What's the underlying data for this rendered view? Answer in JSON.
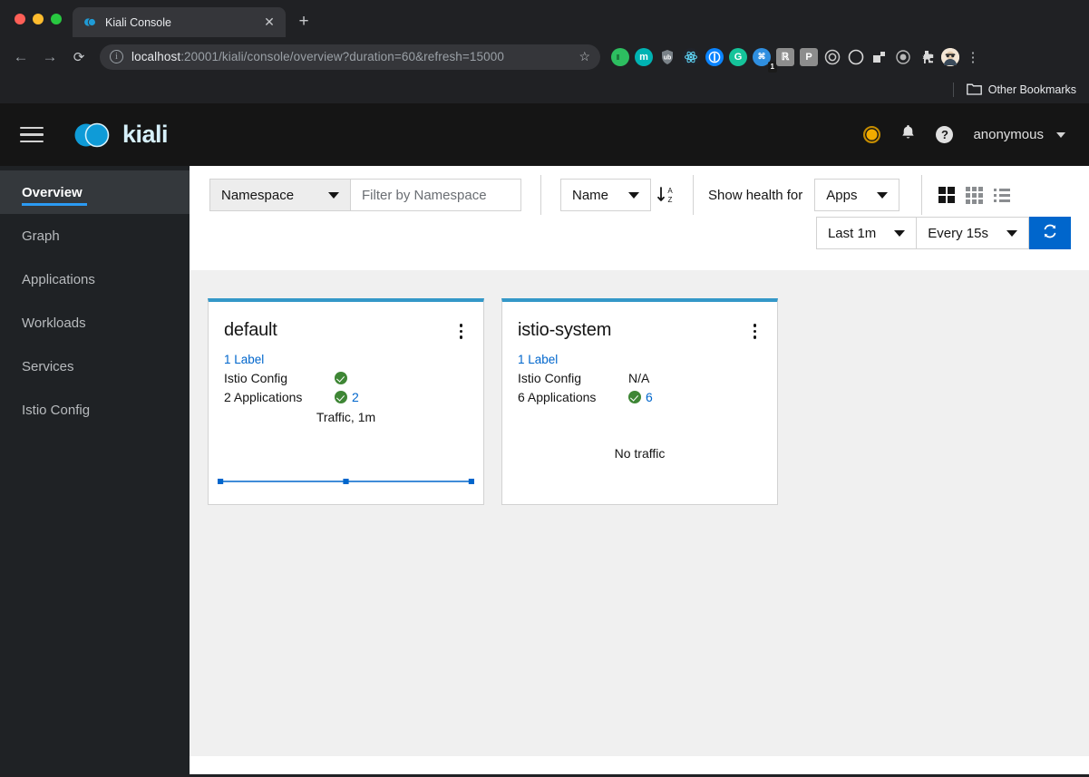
{
  "browser": {
    "tab": {
      "title": "Kiali Console",
      "favicon": "kiali-favicon",
      "close_label": "✕"
    },
    "new_tab_label": "+",
    "nav": {
      "back": "←",
      "forward": "→",
      "reload": "⟳"
    },
    "omnibox": {
      "info_glyph": "i",
      "url_host": "localhost",
      "url_rest": ":20001/kiali/console/overview?duration=60&refresh=15000",
      "star": "☆"
    },
    "extensions": [
      {
        "name": "evernote-extension-icon",
        "color": "#2dbe60",
        "glyph": "❦"
      },
      {
        "name": "mega-extension-icon",
        "color": "#00b3b3",
        "glyph": "m"
      },
      {
        "name": "ublock-extension-icon",
        "color": "#7a8288",
        "glyph": "ü"
      },
      {
        "name": "react-devtools-extension-icon",
        "color": "#20232a",
        "glyph": "⚛"
      },
      {
        "name": "onepassword-extension-icon",
        "color": "#0a84ff",
        "glyph": "Ⓘ"
      },
      {
        "name": "grammarly-extension-icon",
        "color": "#15c39a",
        "glyph": "G"
      },
      {
        "name": "grasshopper-extension-icon",
        "color": "#2f8fe0",
        "glyph": "⌘",
        "badge": "1"
      },
      {
        "name": "honey-extension-icon",
        "color": "#8d8d8d",
        "glyph": "฿"
      },
      {
        "name": "pocket-extension-icon",
        "color": "#8d8d8d",
        "glyph": "P"
      },
      {
        "name": "target-extension-icon",
        "color": "#1b1b1b",
        "glyph": "◎"
      },
      {
        "name": "moon-extension-icon",
        "color": "#1b1b1b",
        "glyph": "◔"
      },
      {
        "name": "layers-extension-icon",
        "color": "#1b1b1b",
        "glyph": "⬛"
      },
      {
        "name": "disc-extension-icon",
        "color": "#1b1b1b",
        "glyph": "◉"
      },
      {
        "name": "puzzle-extensions-icon",
        "color": "#1b1b1b",
        "glyph": "❖"
      },
      {
        "name": "profile-avatar",
        "color": "#f2e3cf",
        "glyph": "☺"
      }
    ],
    "menu_glyph": "⋮",
    "bookmarks": {
      "folder_icon": "folder-icon",
      "other_bookmarks": "Other Bookmarks"
    }
  },
  "masthead": {
    "hamburger": "menu-icon",
    "brand": "kiali",
    "istio_status": "istio-status-warning-icon",
    "notifications": "bell-icon",
    "help": "help-icon",
    "user": "anonymous",
    "user_caret": "chevron-down-icon"
  },
  "sidebar": {
    "items": [
      {
        "label": "Overview",
        "active": true
      },
      {
        "label": "Graph",
        "active": false
      },
      {
        "label": "Applications",
        "active": false
      },
      {
        "label": "Workloads",
        "active": false
      },
      {
        "label": "Services",
        "active": false
      },
      {
        "label": "Istio Config",
        "active": false
      }
    ]
  },
  "toolbar": {
    "filter_type": "Namespace",
    "filter_placeholder": "Filter by Namespace",
    "filter_value": "",
    "sort_by": "Name",
    "sort_direction_icon": "sort-descending-az-icon",
    "health_label": "Show health for",
    "health_for": "Apps",
    "views": [
      {
        "name": "expand-view-icon",
        "selected": true
      },
      {
        "name": "compact-grid-view-icon",
        "selected": false
      },
      {
        "name": "list-view-icon",
        "selected": false
      }
    ],
    "duration": "Last 1m",
    "refresh_interval": "Every 15s",
    "refresh_button_icon": "refresh-icon"
  },
  "cards": [
    {
      "name": "default",
      "kebab": "card-actions-icon",
      "labels": "1 Label",
      "istio_config_label": "Istio Config",
      "istio_config_status": "healthy",
      "istio_config_value": "",
      "apps_label": "2 Applications",
      "apps_status": "healthy",
      "apps_value": "2",
      "traffic_label": "Traffic, 1m",
      "has_sparkline": true,
      "no_traffic_label": ""
    },
    {
      "name": "istio-system",
      "kebab": "card-actions-icon",
      "labels": "1 Label",
      "istio_config_label": "Istio Config",
      "istio_config_status": "na",
      "istio_config_value": "N/A",
      "apps_label": "6 Applications",
      "apps_status": "healthy",
      "apps_value": "6",
      "traffic_label": "",
      "has_sparkline": false,
      "no_traffic_label": "No traffic"
    }
  ],
  "chart_data": {
    "type": "line",
    "title": "Traffic, 1m",
    "x": [
      0,
      30,
      60
    ],
    "values": [
      0,
      0,
      0
    ],
    "xlabel": "",
    "ylabel": "",
    "ylim": [
      0,
      1
    ],
    "grid": false,
    "legend": "none",
    "color": "#06c"
  },
  "colors": {
    "accent_blue": "#06c",
    "card_top_border": "#3498c8",
    "health_green": "#3e8635",
    "warning_orange": "#f0ab00",
    "nav_active_underline": "#2b9af3"
  }
}
